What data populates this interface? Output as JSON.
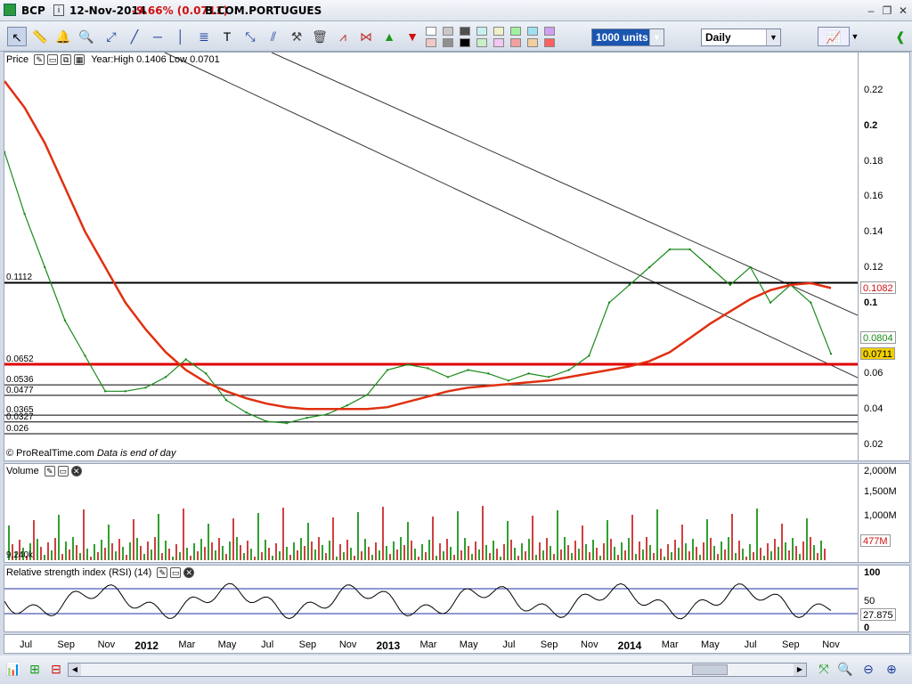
{
  "titlebar": {
    "symbol": "BCP",
    "date": "12-Nov-2014",
    "change": "-9.66% (0.0711)",
    "name": "B.COM.PORTUGUES"
  },
  "toolbar": {
    "units": "1000 units",
    "period": "Daily",
    "swatches": [
      "#ffffff",
      "#f0c8c8",
      "#c8c8c8",
      "#909090",
      "#505050",
      "#000000",
      "#c8f0f0",
      "#c8f0c8",
      "#f0f0c8",
      "#f0c8f0",
      "#a0f0a0",
      "#f0a0a0",
      "#a0e0f0",
      "#f0d0a0",
      "#d0a0f0",
      "#ff6060"
    ]
  },
  "price_panel": {
    "label": "Price",
    "info": "Year:High 0.1406 Low 0.0701",
    "footer": "© ProRealTime.com",
    "footer_note": "Data is end of day",
    "yticks": [
      "0.22",
      "0.2",
      "0.18",
      "0.16",
      "0.14",
      "0.12",
      "0.1",
      "0.08",
      "0.06",
      "0.04",
      "0.02"
    ],
    "hlines": [
      "0.1112",
      "0.0652",
      "0.0536",
      "0.0477",
      "0.0365",
      "0.0327",
      "0.026"
    ],
    "tags": [
      "0.1082",
      "0.0804",
      "0.0711"
    ]
  },
  "volume_panel": {
    "label": "Volume",
    "corner": "9,240k",
    "yticks": [
      "2,000M",
      "1,500M",
      "1,000M"
    ],
    "tag": "477M"
  },
  "rsi_panel": {
    "label": "Relative strength index (RSI) (14)",
    "yticks": [
      "100",
      "50",
      "0"
    ],
    "tag": "27.875"
  },
  "date_axis": [
    "Jul",
    "Sep",
    "Nov",
    "2012",
    "Mar",
    "May",
    "Jul",
    "Sep",
    "Nov",
    "2013",
    "Mar",
    "May",
    "Jul",
    "Sep",
    "Nov",
    "2014",
    "Mar",
    "May",
    "Jul",
    "Sep",
    "Nov"
  ],
  "chart_data": {
    "type": "line",
    "x": [
      "2011-06",
      "2011-07",
      "2011-08",
      "2011-09",
      "2011-10",
      "2011-11",
      "2011-12",
      "2012-01",
      "2012-02",
      "2012-03",
      "2012-04",
      "2012-05",
      "2012-06",
      "2012-07",
      "2012-08",
      "2012-09",
      "2012-10",
      "2012-11",
      "2012-12",
      "2013-01",
      "2013-02",
      "2013-03",
      "2013-04",
      "2013-05",
      "2013-06",
      "2013-07",
      "2013-08",
      "2013-09",
      "2013-10",
      "2013-11",
      "2013-12",
      "2014-01",
      "2014-02",
      "2014-03",
      "2014-04",
      "2014-05",
      "2014-06",
      "2014-07",
      "2014-08",
      "2014-09",
      "2014-10",
      "2014-11"
    ],
    "series": [
      {
        "values": [
          0.185,
          0.15,
          0.12,
          0.09,
          0.07,
          0.05,
          0.05,
          0.052,
          0.058,
          0.068,
          0.06,
          0.045,
          0.038,
          0.033,
          0.032,
          0.035,
          0.037,
          0.042,
          0.048,
          0.062,
          0.065,
          0.063,
          0.058,
          0.062,
          0.06,
          0.056,
          0.06,
          0.058,
          0.062,
          0.07,
          0.1,
          0.11,
          0.12,
          0.13,
          0.13,
          0.12,
          0.11,
          0.12,
          0.1,
          0.11,
          0.1,
          0.0711
        ]
      },
      {
        "values": [
          0.225,
          0.21,
          0.19,
          0.165,
          0.14,
          0.12,
          0.1,
          0.085,
          0.072,
          0.062,
          0.055,
          0.05,
          0.046,
          0.043,
          0.041,
          0.04,
          0.04,
          0.04,
          0.04,
          0.041,
          0.044,
          0.047,
          0.05,
          0.052,
          0.053,
          0.054,
          0.055,
          0.056,
          0.058,
          0.06,
          0.062,
          0.064,
          0.067,
          0.072,
          0.08,
          0.088,
          0.095,
          0.102,
          0.107,
          0.11,
          0.111,
          0.1082
        ]
      }
    ],
    "ylim": [
      0.02,
      0.23
    ],
    "hlines": [
      0.1112,
      0.0652,
      0.0536,
      0.0477,
      0.0365,
      0.0327,
      0.026
    ],
    "volume": [],
    "rsi": []
  }
}
